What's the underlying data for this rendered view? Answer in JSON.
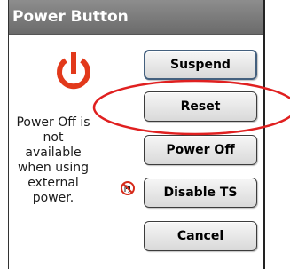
{
  "window": {
    "title": "Power Button"
  },
  "message": {
    "lines": [
      "Power Off is",
      "not available",
      "when using",
      "external",
      "power."
    ]
  },
  "buttons": {
    "suspend": "Suspend",
    "reset": "Reset",
    "power_off": "Power Off",
    "disable_ts": "Disable TS",
    "cancel": "Cancel"
  },
  "icons": {
    "power": "power-icon",
    "touchscreen_disabled": "touch-disabled-icon"
  },
  "colors": {
    "titlebar": "#7a7a7a",
    "power_icon": "#e2391b",
    "annotation": "#e02020",
    "suspend_border": "#44607e"
  }
}
